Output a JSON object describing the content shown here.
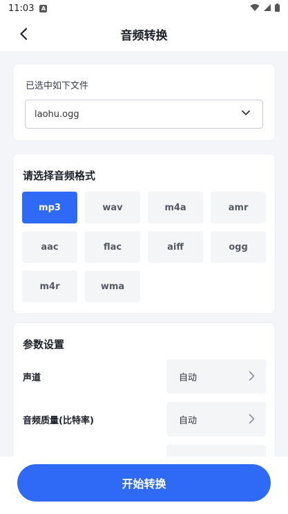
{
  "status_bar": {
    "time": "11:03",
    "notification_badge": "A"
  },
  "header": {
    "title": "音频转换"
  },
  "file_section": {
    "label": "已选中如下文件",
    "selected_file": "laohu.ogg"
  },
  "format_section": {
    "title": "请选择音频格式",
    "formats": [
      "mp3",
      "wav",
      "m4a",
      "amr",
      "aac",
      "flac",
      "aiff",
      "ogg",
      "m4r",
      "wma"
    ],
    "selected": "mp3"
  },
  "params_section": {
    "title": "参数设置",
    "rows": [
      {
        "label": "声道",
        "value": "自动"
      },
      {
        "label": "音频质量(比特率)",
        "value": "自动"
      }
    ]
  },
  "actions": {
    "start_label": "开始转换"
  },
  "colors": {
    "accent": "#2f6af6",
    "background": "#f3f5f9",
    "chip": "#f4f5f7"
  }
}
